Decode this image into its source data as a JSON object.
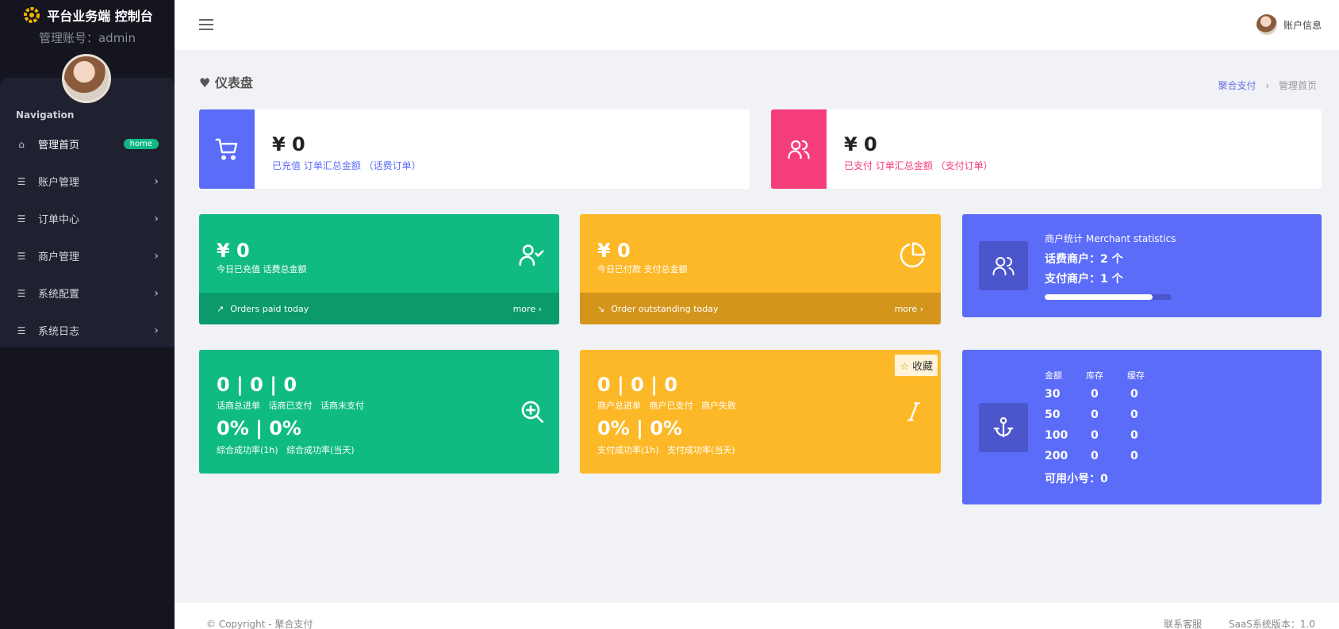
{
  "brand": {
    "title": "平台业务端 控制台",
    "admin_label": "管理账号：admin"
  },
  "sidebar": {
    "nav_title": "Navigation",
    "items": [
      {
        "label": "管理首页",
        "badge": "home"
      },
      {
        "label": "账户管理"
      },
      {
        "label": "订单中心"
      },
      {
        "label": "商户管理"
      },
      {
        "label": "系统配置"
      },
      {
        "label": "系统日志"
      }
    ]
  },
  "topbar": {
    "account_label": "账户信息"
  },
  "page": {
    "title": "仪表盘"
  },
  "breadcrumb": {
    "root": "聚合支付",
    "current": "管理首页"
  },
  "top_cards": [
    {
      "value": "¥ 0",
      "sub": "已充值 订单汇总金额 （话费订单）",
      "color": "#5b6cf9"
    },
    {
      "value": "¥ 0",
      "sub": "已支付 订单汇总金额 （支付订单）",
      "color": "#f53d7a"
    }
  ],
  "mid_cards": [
    {
      "value": "¥ 0",
      "sub": "今日已充值 话费总金额",
      "footer": "Orders paid today",
      "more": "more"
    },
    {
      "value": "¥ 0",
      "sub": "今日已付款 支付总金额",
      "footer": "Order outstanding today",
      "more": "more"
    }
  ],
  "merchant": {
    "title": "商户统计",
    "title_en": "Merchant statistics",
    "phone_merchants": "话费商户：2 个",
    "pay_merchants": "支付商户：1 个",
    "progress": 0.85
  },
  "phone_orders": {
    "nums": "0 | 0 | 0",
    "labels": [
      "话商总进单",
      "话商已支付",
      "话商未支付"
    ],
    "pct": "0% | 0%",
    "pct_labels": [
      "综合成功率(1h)",
      "综合成功率(当天)"
    ]
  },
  "merchant_orders": {
    "nums": "0 | 0 | 0",
    "labels": [
      "商户总进单",
      "商户已支付",
      "商户失败"
    ],
    "pct": "0% | 0%",
    "pct_labels": [
      "支付成功率(1h)",
      "支付成功率(当天)"
    ],
    "fav": "收藏"
  },
  "stock": {
    "headers": [
      "金额",
      "库存",
      "缓存"
    ],
    "rows": [
      [
        "30",
        "0",
        "0"
      ],
      [
        "50",
        "0",
        "0"
      ],
      [
        "100",
        "0",
        "0"
      ],
      [
        "200",
        "0",
        "0"
      ]
    ],
    "available": "可用小号：0"
  },
  "footer": {
    "copyright": "© Copyright - 聚合支付",
    "contact": "联系客服",
    "version": "SaaS系统版本：1.0"
  },
  "colors": {
    "green": "#10bb83",
    "yellow": "#fdb827",
    "blue": "#5b6cf9",
    "pink": "#f53d7a",
    "sidebar": "#14151f"
  }
}
